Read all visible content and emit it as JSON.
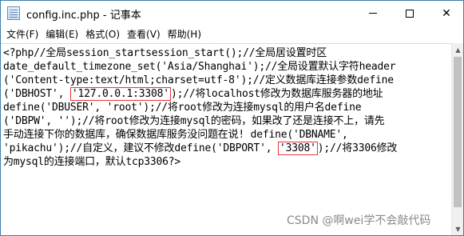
{
  "window": {
    "title": "config.inc.php - 记事本",
    "minimize_label": "—",
    "maximize_label": "☐",
    "close_label": "✕"
  },
  "menu": {
    "items": [
      {
        "label": "文件(F)"
      },
      {
        "label": "编辑(E)"
      },
      {
        "label": "格式(O)"
      },
      {
        "label": "查看(V)"
      },
      {
        "label": "帮助(H)"
      }
    ]
  },
  "editor": {
    "lines": [
      {
        "text": "<?php//全局session_startsession_start();//全局居设置时区"
      },
      {
        "text": "date_default_timezone_set('Asia/Shanghai');//全局设置默认字符header"
      },
      {
        "text": "('Content-type:text/html;charset=utf-8');//定义数据库连接参数define"
      },
      {
        "pre": "('DBHOST', ",
        "hl": "'127.0.0.1:3308'",
        "post": ");//将localhost修改为数据库服务器的地址"
      },
      {
        "text": "define('DBUSER', 'root');//将root修改为连接mysql的用户名define"
      },
      {
        "text": "('DBPW', '');//将root修改为连接mysql的密码，如果改了还是连接不上，请先"
      },
      {
        "text": "手动连接下你的数据库，确保数据库服务没问题在说! define('DBNAME',"
      },
      {
        "pre": "'pikachu');//自定义，建议不修改define('DBPORT', ",
        "hl": "'3308'",
        "post": ");//将3306修改"
      },
      {
        "text": "为mysql的连接端口，默认tcp3306?>"
      }
    ]
  },
  "watermark": {
    "text": "CSDN @啊wei学不会敲代码"
  }
}
